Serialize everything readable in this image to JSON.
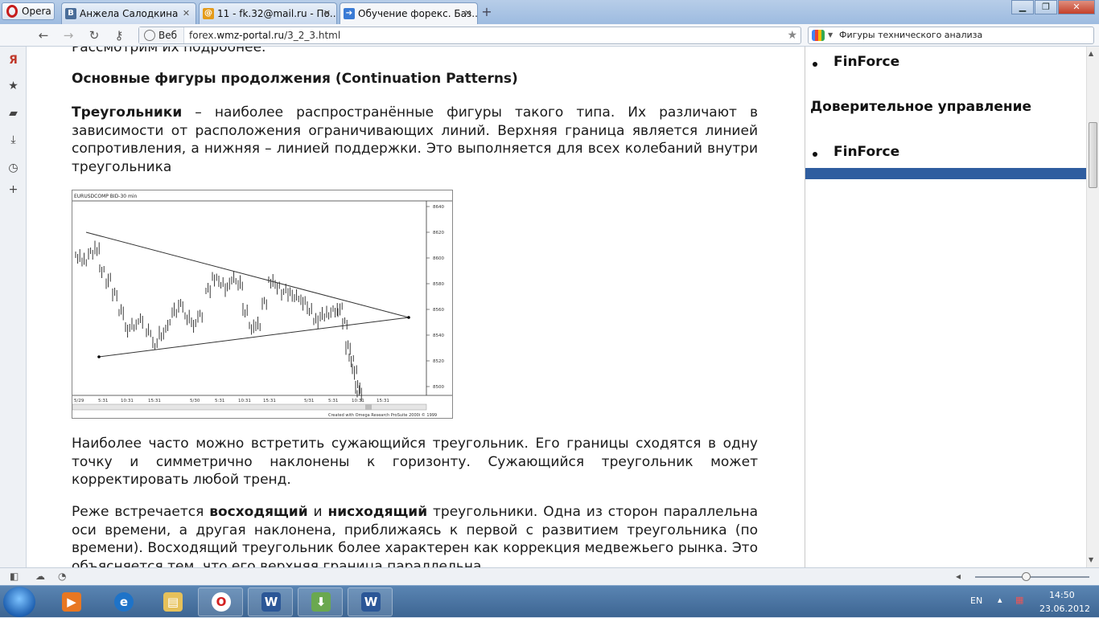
{
  "browser": {
    "menu_label": "Opera",
    "tabs": [
      {
        "icon": "vk-icon",
        "title": "Анжела Салодкина"
      },
      {
        "icon": "mailru-icon",
        "title": "11 - fk.32@mail.ru - По..."
      },
      {
        "icon": "page-icon",
        "title": "Обучение форекс. Баз..."
      }
    ],
    "web_label": "Веб",
    "url_prefix": "forex.",
    "url_domain": "wmz-portal.ru",
    "url_path": "/3_2_3.html",
    "search_text": "Фигуры технического анализа"
  },
  "article": {
    "cut_line": "Рассмотрим их подробнее.",
    "heading": "Основные фигуры продолжения (Continuation Patterns)",
    "p1_bold": "Треугольники",
    "p1_text": " – наиболее распространённые фигуры такого типа. Их различают в зависимости от расположения ограничивающих линий. Верхняя граница является линией сопротивления, а нижняя – линией поддержки. Это выполняется для всех колебаний внутри треугольника",
    "p2_text": "Наиболее часто можно встретить сужающийся треугольник. Его границы сходятся в одну точку и симметрично наклонены к горизонту. Сужающийся треугольник может корректировать любой тренд.",
    "p3_a": "Реже встречается ",
    "p3_b1": "восходящий",
    "p3_c": " и ",
    "p3_b2": "нисходящий",
    "p3_d": " треугольники. Одна из сторон параллельна оси времени, а другая наклонена, приближаясь к первой с развитием треугольника (по времени). Восходящий треугольник более характерен как коррекция медвежьего рынка. Это объясняется тем, что его верхняя граница параллельна"
  },
  "chart_data": {
    "type": "bar",
    "title": "EURUSDCOMP BID-30 min",
    "footer": "Created with Omega Research ProSuite 2000i © 1999",
    "yticks": [
      "8640",
      "8620",
      "8600",
      "8580",
      "8560",
      "8540",
      "8520",
      "8500"
    ],
    "xticks": [
      "5/29",
      "5:31",
      "10:31",
      "15:31",
      "5/30",
      "5:31",
      "10:31",
      "15:31",
      "5/31",
      "5:31",
      "10:31",
      "15:31"
    ],
    "ylim": [
      8495,
      8645
    ]
  },
  "sidebar": {
    "item1": "FinForce",
    "heading": "Доверительное управление",
    "item2": "FinForce"
  },
  "taskbar": {
    "lang": "EN",
    "time": "14:50",
    "date": "23.06.2012"
  }
}
